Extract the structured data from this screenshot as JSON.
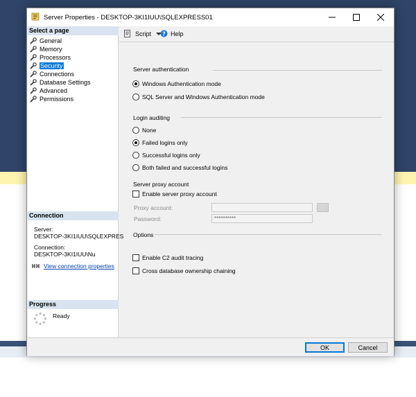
{
  "dialog": {
    "title": "Server Properties - DESKTOP-3KI1IUU\\SQLEXPRESS01",
    "minimize_icon": "minimize-icon",
    "maximize_icon": "maximize-icon",
    "close_icon": "close-icon"
  },
  "left_pane": {
    "select_page_header": "Select a page",
    "pages": [
      {
        "label": "General",
        "selected": false
      },
      {
        "label": "Memory",
        "selected": false
      },
      {
        "label": "Processors",
        "selected": false
      },
      {
        "label": "Security",
        "selected": true
      },
      {
        "label": "Connections",
        "selected": false
      },
      {
        "label": "Database Settings",
        "selected": false
      },
      {
        "label": "Advanced",
        "selected": false
      },
      {
        "label": "Permissions",
        "selected": false
      }
    ],
    "connection_header": "Connection",
    "server_label": "Server:",
    "server_value": "DESKTOP-3KI1IUU\\SQLEXPRES",
    "connection_label": "Connection:",
    "connection_value": "DESKTOP-3KI1IUU\\Nu",
    "view_connection_link": "View connection properties",
    "progress_header": "Progress",
    "progress_status": "Ready"
  },
  "toolbar": {
    "script_label": "Script",
    "help_label": "Help"
  },
  "security": {
    "server_auth_header": "Server authentication",
    "auth_options": [
      "Windows Authentication mode",
      "SQL Server and Windows Authentication mode"
    ],
    "auth_selected": 0,
    "login_auditing_header": "Login auditing",
    "audit_options": [
      "None",
      "Failed logins only",
      "Successful logins only",
      "Both failed and successful logins"
    ],
    "audit_selected": 1,
    "proxy_header": "Server proxy account",
    "enable_proxy_label": "Enable server proxy account",
    "proxy_account_label": "Proxy account:",
    "proxy_account_value": "",
    "password_label": "Password:",
    "password_value": "**********",
    "options_header": "Options",
    "c2_audit_label": "Enable C2 audit tracing",
    "cross_db_label": "Cross database ownership chaining"
  },
  "footer": {
    "ok_label": "OK",
    "cancel_label": "Cancel"
  },
  "colors": {
    "selection": "#0078d7",
    "section_header_bg": "#d9e3ef",
    "background_app": "#2f4468"
  }
}
